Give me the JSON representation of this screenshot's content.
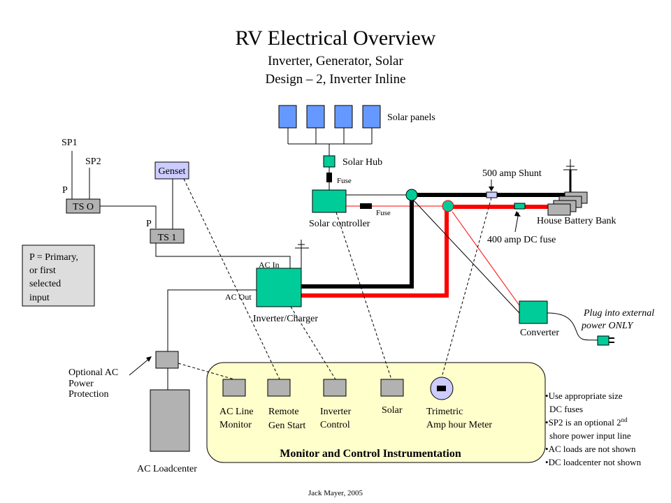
{
  "title": "RV Electrical Overview",
  "subtitle_1": "Inverter, Generator, Solar",
  "subtitle_2": "Design – 2, Inverter Inline",
  "colors": {
    "component_green": "#00CC99",
    "solar_panel_blue": "#6699FF",
    "light_lavender": "#CCCCFF",
    "gray_box": "#B2B2B2",
    "legend_gray": "#DDDDDD",
    "panel_yellow": "#FFFFCC",
    "positive_red": "#FF0000",
    "negative_black": "#000000"
  },
  "labels": {
    "solar_panels": "Solar panels",
    "solar_hub": "Solar Hub",
    "fuse_top": "Fuse",
    "fuse_controller": "Fuse",
    "solar_controller": "Solar controller",
    "shunt": "500 amp Shunt",
    "battery_bank": "House Battery  Bank",
    "dc_fuse": "400 amp DC fuse",
    "sp1": "SP1",
    "sp2": "SP2",
    "p_ts0": "P",
    "p_ts1": "P",
    "ts0": "TS O",
    "ts1": "TS 1",
    "genset": "Genset",
    "ac_in": "AC In",
    "ac_out": "AC Out",
    "inverter_charger": "Inverter/Charger",
    "converter": "Converter",
    "plug_line1": "Plug into external",
    "plug_line2": "power ONLY",
    "optional_ac_1": "Optional AC",
    "optional_ac_2": "Power",
    "optional_ac_3": "Protection",
    "ac_loadcenter": "AC Loadcenter",
    "footer": "Jack Mayer, 2005"
  },
  "legend": {
    "lines": [
      "P = Primary,",
      "or first",
      "selected",
      "input"
    ]
  },
  "instrumentation": {
    "title": "Monitor and Control Instrumentation",
    "items": [
      {
        "line1": "AC Line",
        "line2": "Monitor"
      },
      {
        "line1": "Remote",
        "line2": "Gen Start"
      },
      {
        "line1": "Inverter",
        "line2": "Control"
      },
      {
        "line1": "Solar",
        "line2": ""
      },
      {
        "line1": "Trimetric",
        "line2": "Amp hour Meter"
      }
    ]
  },
  "notes": {
    "items": [
      {
        "bullet": "•",
        "line1": "Use appropriate size",
        "line2": "DC fuses",
        "sup": ""
      },
      {
        "bullet": "•",
        "line1": "SP2 is an optional 2",
        "line2": "shore power input line",
        "sup": "nd"
      },
      {
        "bullet": "•",
        "line1": "AC loads are not shown",
        "line2": "",
        "sup": ""
      },
      {
        "bullet": "•",
        "line1": "DC loadcenter not shown",
        "line2": "",
        "sup": ""
      }
    ]
  }
}
